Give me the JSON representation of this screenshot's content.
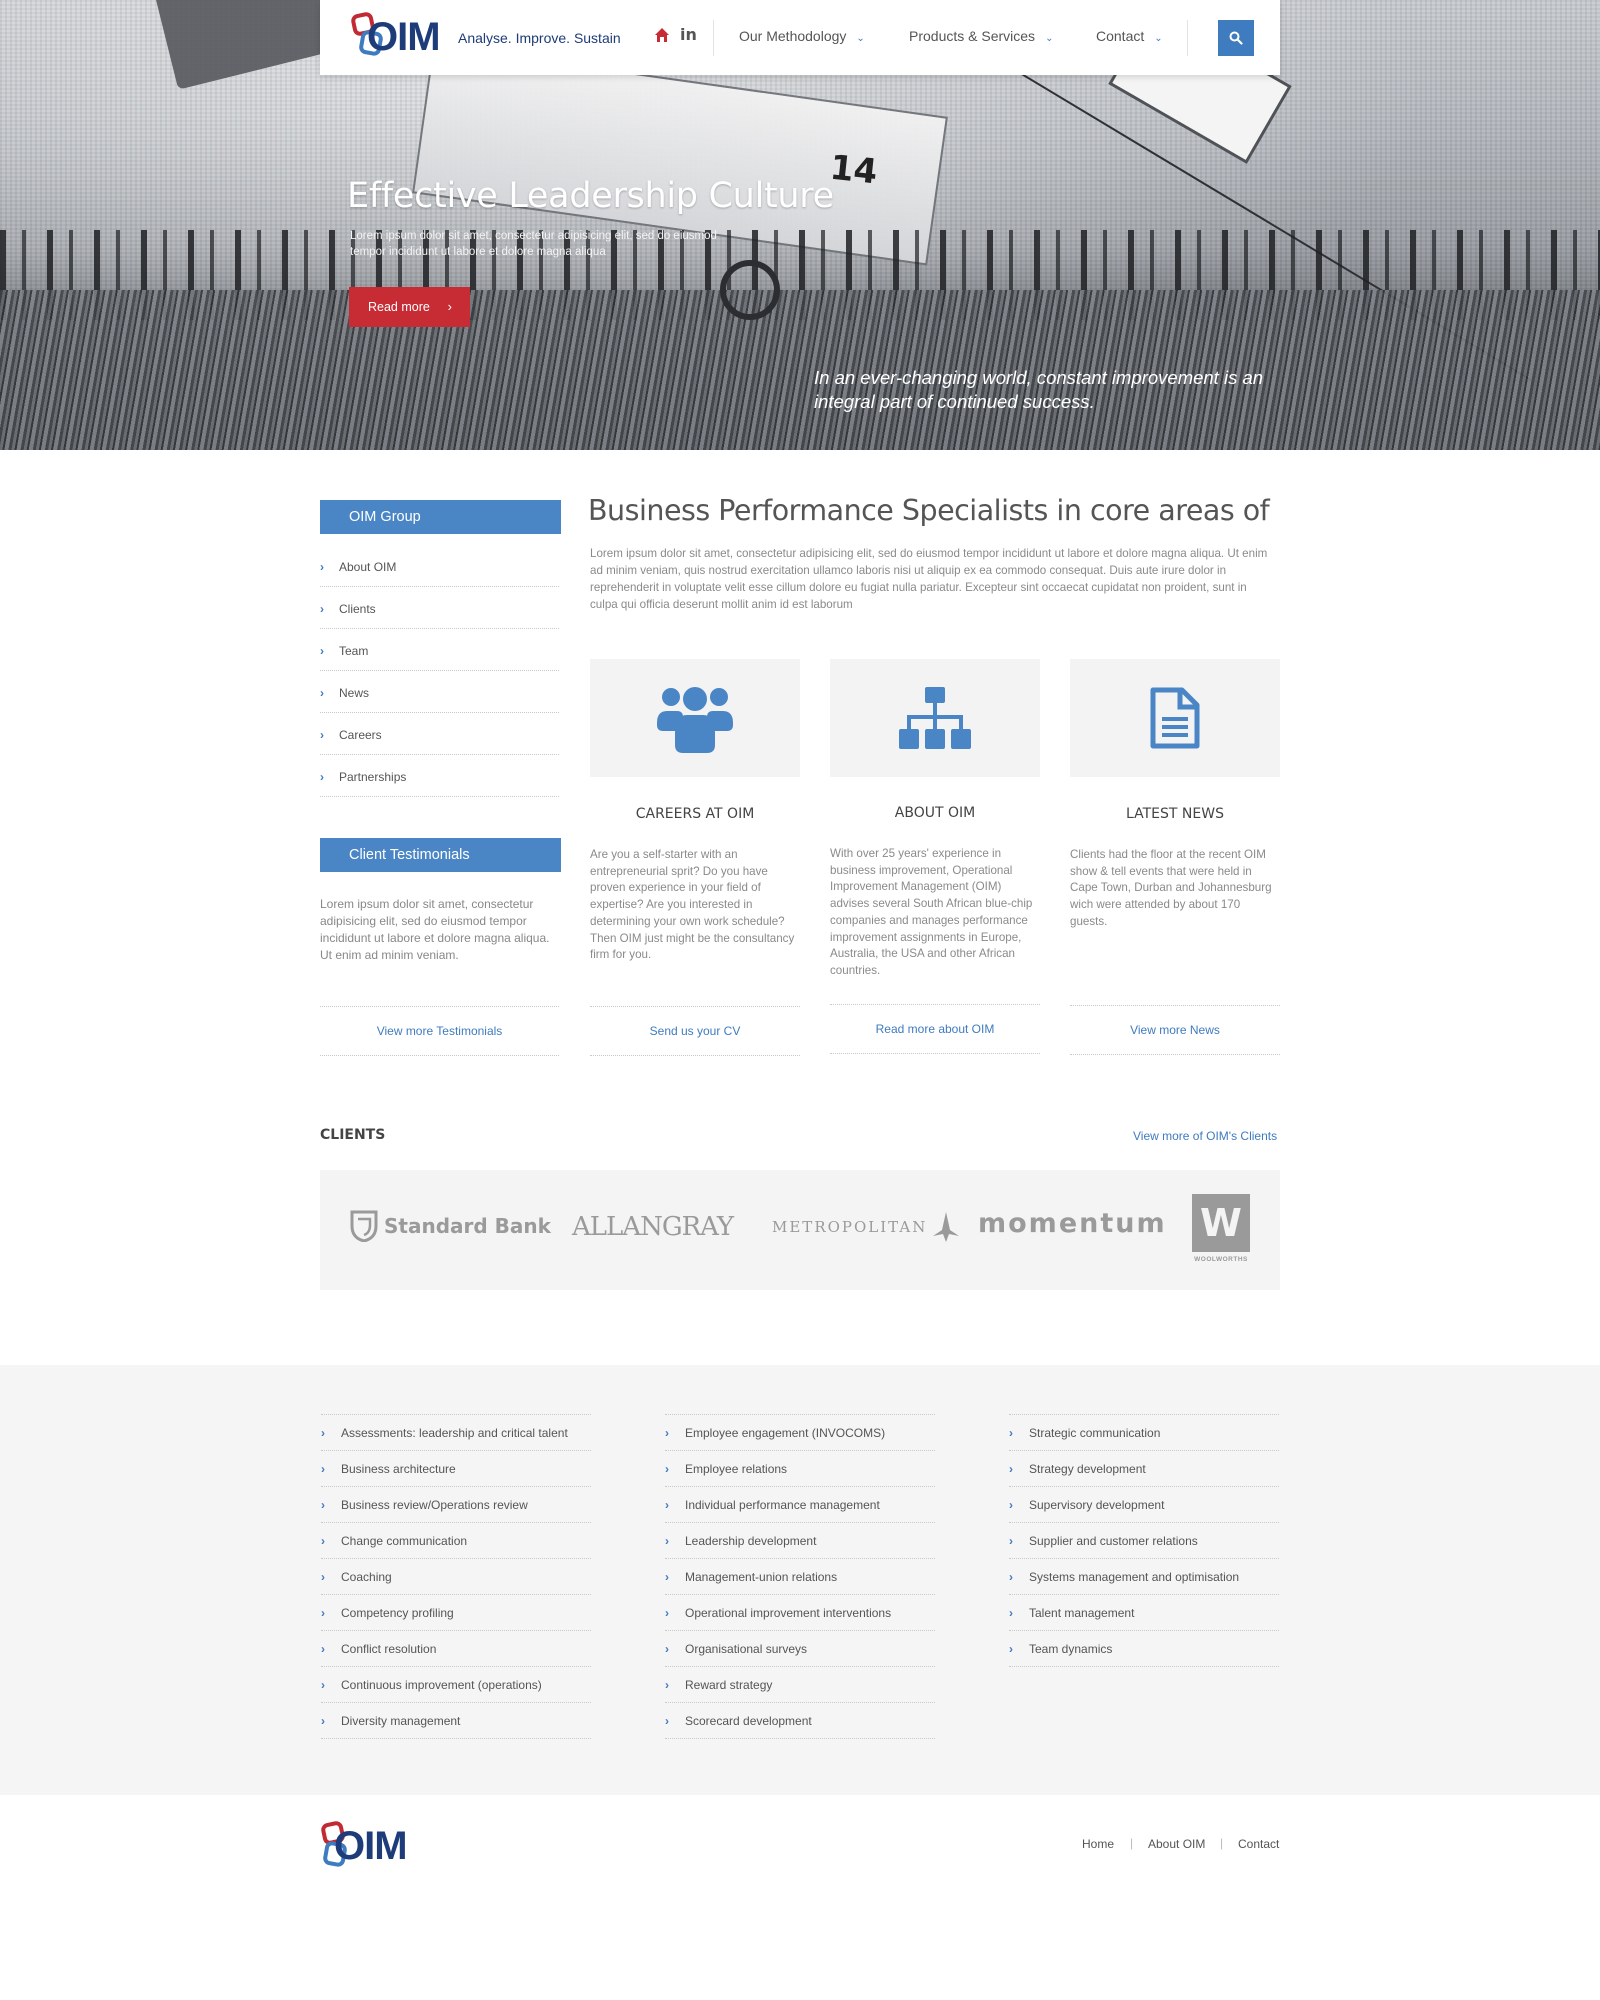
{
  "header": {
    "logo_text": "OIM",
    "tagline": "Analyse. Improve. Sustain",
    "social_linkedin": "in",
    "nav": [
      {
        "label": "Our Methodology"
      },
      {
        "label": "Products & Services"
      },
      {
        "label": "Contact"
      }
    ]
  },
  "hero": {
    "title": "Effective Leadership Culture",
    "subtitle": "Lorem ipsum dolor sit amet, consectetur adipisicing elit, sed do eiusmod tempor incididunt ut labore et dolore magna aliqua",
    "button_label": "Read more",
    "quote": "In an ever-changing world, constant improvement is an integral part of continued success.",
    "plane_number": "14"
  },
  "sidebar": {
    "group_title": "OIM Group",
    "items": [
      {
        "label": "About OIM"
      },
      {
        "label": "Clients"
      },
      {
        "label": "Team"
      },
      {
        "label": "News"
      },
      {
        "label": "Careers"
      },
      {
        "label": "Partnerships"
      }
    ],
    "testimonials_title": "Client Testimonials",
    "testimonials_text": "Lorem ipsum dolor sit amet, consectetur adipisicing elit, sed do eiusmod tempor incididunt ut labore et dolore magna aliqua. Ut enim ad minim veniam.",
    "testimonials_link": "View more Testimonials"
  },
  "main": {
    "title": "Business Performance Specialists in core areas of",
    "intro": "Lorem ipsum dolor sit amet, consectetur adipisicing elit, sed do eiusmod tempor incididunt ut labore et dolore magna aliqua. Ut enim ad minim veniam, quis nostrud exercitation ullamco laboris nisi ut aliquip ex ea commodo consequat. Duis aute irure dolor in reprehenderit in voluptate velit esse cillum dolore eu fugiat nulla pariatur. Excepteur sint occaecat cupidatat non proident, sunt in culpa qui officia deserunt mollit anim id est laborum",
    "cards": [
      {
        "icon": "group-icon",
        "title": "CAREERS AT OIM",
        "text": "Are you a self-starter with an entrepreneurial sprit? Do you have proven experience in your field of expertise? Are you interested in determining your own work schedule? Then OIM just might be the consultancy firm for you.",
        "link": "Send us your CV"
      },
      {
        "icon": "sitemap-icon",
        "title": "ABOUT OIM",
        "text": "With over 25 years' experience in business improvement, Operational Improvement Management (OIM) advises several South African blue-chip companies and manages performance improvement assignments in Europe, Australia, the USA and other African countries.",
        "link": "Read more about OIM"
      },
      {
        "icon": "document-icon",
        "title": "LATEST NEWS",
        "text": "Clients had the floor at the recent OIM show & tell events that were held in Cape Town, Durban and Johannesburg wich were attended by about 170 guests.",
        "link": "View more News"
      }
    ]
  },
  "clients": {
    "title": "CLIENTS",
    "more_link": "View more of OIM's Clients",
    "logos": [
      {
        "name": "Standard Bank"
      },
      {
        "name": "ALLANGRAY"
      },
      {
        "name": "METROPOLITAN"
      },
      {
        "name": "momentum"
      },
      {
        "name": "W",
        "sub": "WOOLWORTHS"
      }
    ]
  },
  "services": {
    "columns": [
      [
        "Assessments: leadership and critical talent",
        "Business architecture",
        "Business review/Operations review",
        "Change communication",
        "Coaching",
        "Competency profiling",
        "Conflict resolution",
        "Continuous improvement (operations)",
        "Diversity management"
      ],
      [
        "Employee engagement (INVOCOMS)",
        "Employee relations",
        "Individual performance management",
        "Leadership development",
        "Management-union relations",
        "Operational improvement interventions",
        "Organisational surveys",
        "Reward strategy",
        "Scorecard development"
      ],
      [
        "Strategic communication",
        "Strategy development",
        "Supervisory development",
        "Supplier and customer relations",
        "Systems management and optimisation",
        "Talent management",
        "Team dynamics"
      ]
    ]
  },
  "footer": {
    "logo_text": "OIM",
    "links": [
      "Home",
      "About OIM",
      "Contact"
    ],
    "separator": "|"
  },
  "colors": {
    "accent_blue": "#4a86c5",
    "accent_red": "#c72c34",
    "brand_navy": "#1d3c79"
  }
}
